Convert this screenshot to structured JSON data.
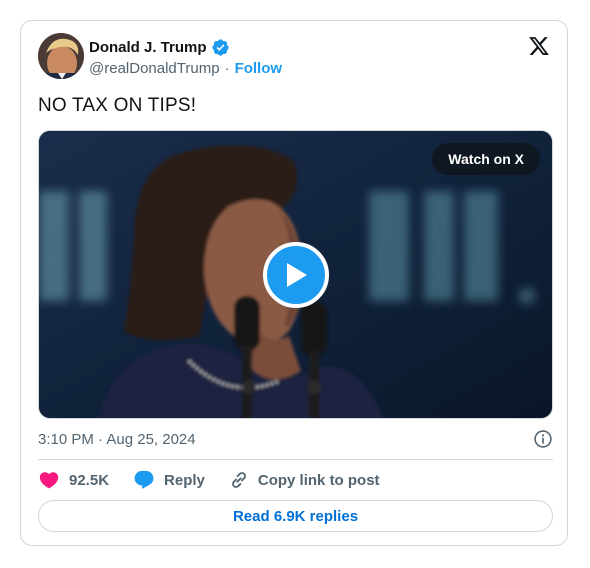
{
  "author": {
    "name": "Donald J. Trump",
    "handle": "@realDonaldTrump",
    "separator": "·",
    "follow_label": "Follow",
    "verified": true,
    "verified_color": "#1d9bf0"
  },
  "tweet": {
    "text": "NO TAX ON TIPS!",
    "timestamp": "3:10 PM · Aug 25, 2024"
  },
  "media": {
    "type": "video",
    "watch_label": "Watch on X",
    "play_icon": "play-icon"
  },
  "actions": {
    "likes": "92.5K",
    "reply_label": "Reply",
    "copy_link_label": "Copy link to post",
    "read_replies_label": "Read 6.9K replies"
  },
  "colors": {
    "accent": "#1d9bf0",
    "like": "#f91880",
    "link": "#006fd6",
    "secondary_text": "#536471",
    "border": "#cfd9de"
  }
}
